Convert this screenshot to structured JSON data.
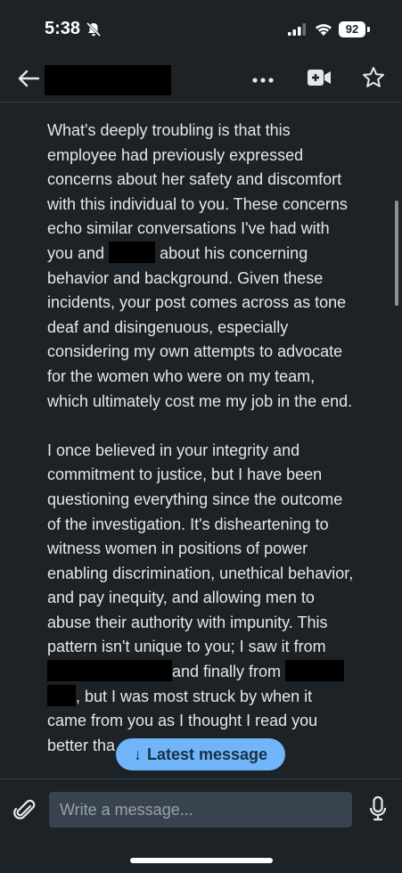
{
  "status_bar": {
    "time": "5:38",
    "battery": "92",
    "icons": [
      "bell-slash-icon",
      "cellular-signal-icon",
      "wifi-icon",
      "battery-icon"
    ]
  },
  "header": {
    "icons": [
      "back-arrow-icon",
      "more-icon",
      "video-call-icon",
      "star-icon"
    ]
  },
  "message": {
    "p1_l1": "What's deeply troubling is that this",
    "p1_l2": "employee had previously expressed",
    "p1_l3": "concerns about her safety and discomfort",
    "p1_l4": "with this individual to you. These concerns",
    "p1_l5": "echo similar conversations I've had with",
    "p1_l6a": "you and",
    "p1_l6b": "about his concerning",
    "p1_l7": "behavior and background. Given these",
    "p1_l8": "incidents, your post comes across as tone",
    "p1_l9": "deaf and disingenuous, especially",
    "p1_l10": "considering my own attempts to advocate",
    "p1_l11": "for the women who were on my team,",
    "p1_l12": "which ultimately cost me my job in the end.",
    "p2_l1": "I once believed in your integrity and",
    "p2_l2": "commitment to justice, but I have been",
    "p2_l3": "questioning everything since the outcome",
    "p2_l4": "of the investigation. It's disheartening to",
    "p2_l5": "witness women in positions of power",
    "p2_l6": "enabling discrimination, unethical behavior,",
    "p2_l7": "and pay inequity, and allowing men to",
    "p2_l8": "abuse their authority with impunity. This",
    "p2_l9": "pattern isn't unique to you; I saw it from",
    "p2_l10": "and finally from",
    "p2_l11": ",  but I was most struck by when it",
    "p2_l12": "came from you as I thought I read you",
    "p2_l13": "better tha"
  },
  "latest_button": {
    "label": "Latest message",
    "arrow": "↓"
  },
  "composer": {
    "placeholder": "Write a message...",
    "icons": [
      "paperclip-icon",
      "microphone-icon"
    ]
  },
  "colors": {
    "background": "#1d2226",
    "accent": "#70b5f9",
    "input": "#38434f"
  }
}
